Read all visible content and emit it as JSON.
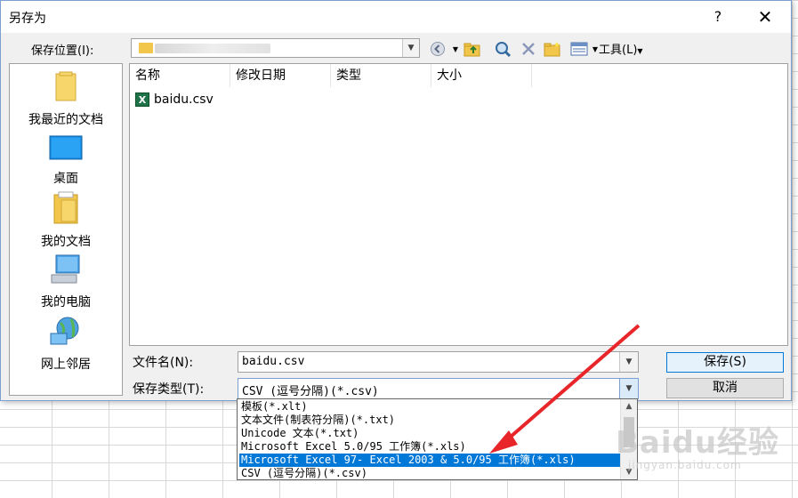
{
  "dialog": {
    "title": "另存为",
    "help_label": "?",
    "close_label": "✕"
  },
  "location": {
    "label": "保存位置(I):",
    "value": ""
  },
  "toolbar": {
    "tools_label": "工具(L)"
  },
  "places": [
    {
      "label": "我最近的文档",
      "icon": "recent-folder-icon"
    },
    {
      "label": "桌面",
      "icon": "desktop-icon"
    },
    {
      "label": "我的文档",
      "icon": "documents-folder-icon"
    },
    {
      "label": "我的电脑",
      "icon": "computer-icon"
    },
    {
      "label": "网上邻居",
      "icon": "network-icon"
    }
  ],
  "filelist": {
    "columns": [
      "名称",
      "修改日期",
      "类型",
      "大小"
    ],
    "files": [
      {
        "name": "baidu.csv",
        "icon": "excel-csv-icon"
      }
    ]
  },
  "filename": {
    "label": "文件名(N):",
    "value": "baidu.csv"
  },
  "filetype": {
    "label": "保存类型(T):",
    "value": "CSV (逗号分隔)(*.csv)",
    "options": [
      "模板(*.xlt)",
      "文本文件(制表符分隔)(*.txt)",
      "Unicode 文本(*.txt)",
      "Microsoft Excel 5.0/95 工作簿(*.xls)",
      "Microsoft Excel 97- Excel 2003 & 5.0/95 工作簿(*.xls)",
      "CSV (逗号分隔)(*.csv)"
    ],
    "selected_index": 4
  },
  "buttons": {
    "save": "保存(S)",
    "cancel": "取消"
  },
  "watermark": {
    "text": "Baidu经验",
    "sub": "jingyan.baidu.com"
  },
  "colors": {
    "selection": "#0078d7",
    "arrow": "#e8262a"
  }
}
